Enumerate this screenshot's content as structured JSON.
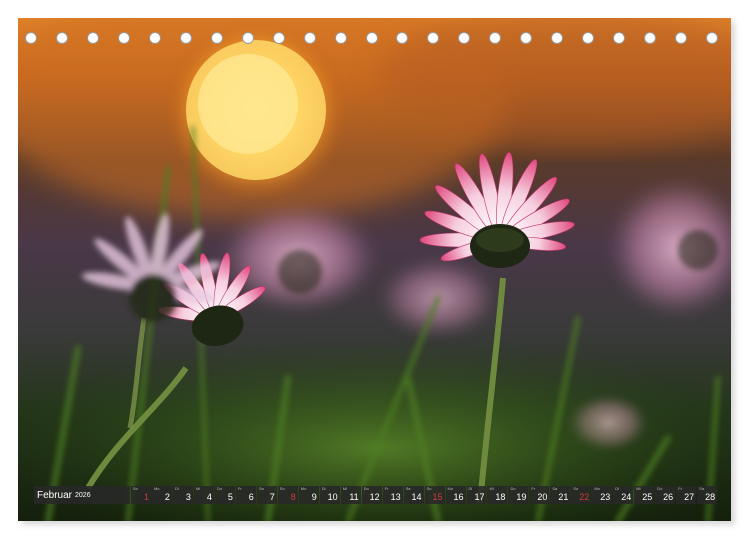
{
  "calendar": {
    "month": "Februar",
    "year": "2026",
    "days": [
      {
        "n": "1",
        "w": "So",
        "weekend": true
      },
      {
        "n": "2",
        "w": "Mo",
        "weekend": false
      },
      {
        "n": "3",
        "w": "Di",
        "weekend": false
      },
      {
        "n": "4",
        "w": "Mi",
        "weekend": false
      },
      {
        "n": "5",
        "w": "Do",
        "weekend": false
      },
      {
        "n": "6",
        "w": "Fr",
        "weekend": false
      },
      {
        "n": "7",
        "w": "Sa",
        "weekend": false
      },
      {
        "n": "8",
        "w": "So",
        "weekend": true
      },
      {
        "n": "9",
        "w": "Mo",
        "weekend": false
      },
      {
        "n": "10",
        "w": "Di",
        "weekend": false
      },
      {
        "n": "11",
        "w": "Mi",
        "weekend": false
      },
      {
        "n": "12",
        "w": "Do",
        "weekend": false
      },
      {
        "n": "13",
        "w": "Fr",
        "weekend": false
      },
      {
        "n": "14",
        "w": "Sa",
        "weekend": false
      },
      {
        "n": "15",
        "w": "So",
        "weekend": true
      },
      {
        "n": "16",
        "w": "Mo",
        "weekend": false
      },
      {
        "n": "17",
        "w": "Di",
        "weekend": false
      },
      {
        "n": "18",
        "w": "Mi",
        "weekend": false
      },
      {
        "n": "19",
        "w": "Do",
        "weekend": false
      },
      {
        "n": "20",
        "w": "Fr",
        "weekend": false
      },
      {
        "n": "21",
        "w": "Sa",
        "weekend": false
      },
      {
        "n": "22",
        "w": "So",
        "weekend": true
      },
      {
        "n": "23",
        "w": "Mo",
        "weekend": false
      },
      {
        "n": "24",
        "w": "Di",
        "weekend": false
      },
      {
        "n": "25",
        "w": "Mi",
        "weekend": false
      },
      {
        "n": "26",
        "w": "Do",
        "weekend": false
      },
      {
        "n": "27",
        "w": "Fr",
        "weekend": false
      },
      {
        "n": "28",
        "w": "Sa",
        "weekend": false
      }
    ]
  },
  "binding_holes": 23,
  "colors": {
    "weekend": "#d23a3a",
    "bar_background": "#282828",
    "sunset": "#f0a020",
    "petal_pink": "#e06090",
    "grass": "#3c6a1e"
  }
}
